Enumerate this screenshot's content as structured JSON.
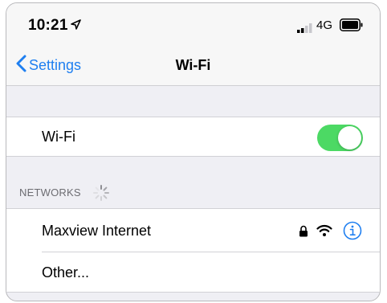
{
  "status_bar": {
    "time": "10:21",
    "network_type": "4G",
    "icons": [
      "location-arrow-icon",
      "signal-icon",
      "battery-icon"
    ]
  },
  "nav": {
    "back_label": "Settings",
    "title": "Wi-Fi"
  },
  "wifi_toggle": {
    "label": "Wi-Fi",
    "enabled": true
  },
  "networks_section": {
    "header": "NETWORKS",
    "items": [
      {
        "label": "Maxview Internet",
        "secured": true,
        "icons": [
          "lock-icon",
          "wifi-signal-icon",
          "info-icon"
        ]
      },
      {
        "label": "Other..."
      }
    ]
  },
  "colors": {
    "accent": "#1f7ff0",
    "toggle_on": "#4cd964",
    "background": "#efeff4"
  }
}
